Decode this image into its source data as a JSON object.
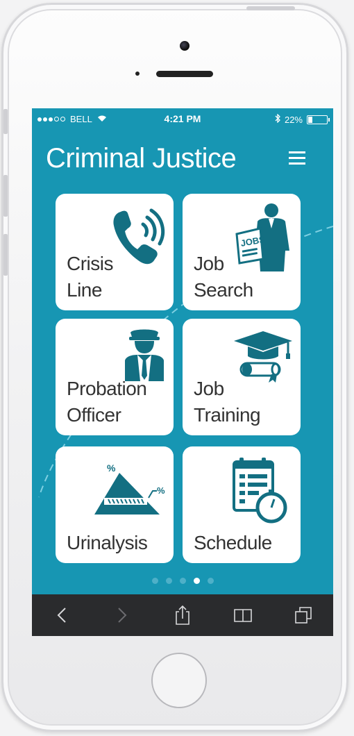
{
  "status_bar": {
    "carrier": "BELL",
    "time": "4:21 PM",
    "battery_percent_text": "22%",
    "battery_level": 0.22,
    "signal_bars_filled": 3,
    "signal_bars_total": 5
  },
  "app": {
    "title": "Criminal Justice",
    "menu_icon": "hamburger-icon",
    "accent_color": "#1796b3",
    "icon_color": "#136f82"
  },
  "tiles": [
    {
      "id": "crisis-line",
      "lines": [
        "Crisis",
        "Line"
      ],
      "icon": "phone-icon"
    },
    {
      "id": "job-search",
      "lines": [
        "Job",
        "Search"
      ],
      "icon": "jobs-newspaper-icon"
    },
    {
      "id": "probation-officer",
      "lines": [
        "Probation",
        "Officer"
      ],
      "icon": "officer-icon"
    },
    {
      "id": "job-training",
      "lines": [
        "Job",
        "Training"
      ],
      "icon": "graduation-cap-icon"
    },
    {
      "id": "urinalysis",
      "lines": [
        "Urinalysis"
      ],
      "icon": "percent-pyramid-icon"
    },
    {
      "id": "schedule",
      "lines": [
        "Schedule"
      ],
      "icon": "clipboard-stopwatch-icon"
    }
  ],
  "pager": {
    "pages": 5,
    "active_index": 3
  },
  "browser_toolbar": {
    "items": [
      "back-icon",
      "forward-icon",
      "share-icon",
      "bookmarks-icon",
      "tabs-icon"
    ]
  }
}
